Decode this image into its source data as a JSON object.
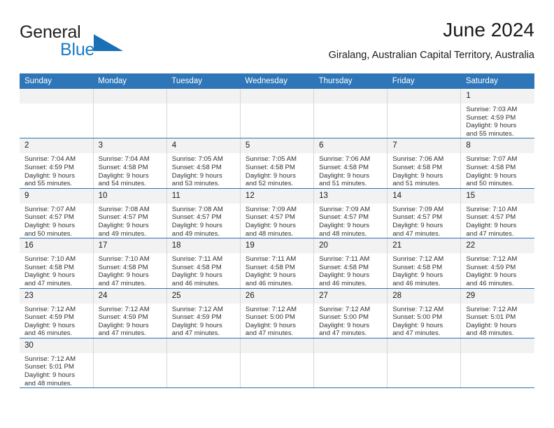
{
  "brand": {
    "name_top": "General",
    "name_bottom": "Blue",
    "triangle_icon": "blue-triangle-icon",
    "accent_color": "#1b7bc4"
  },
  "header": {
    "title": "June 2024",
    "subtitle": "Giralang, Australian Capital Territory, Australia"
  },
  "theme": {
    "header_bg": "#2e76b8",
    "header_text": "#ffffff",
    "daynum_bg": "#f2f2f2",
    "row_divider": "#2e76b8",
    "cell_divider": "#d6d6d6"
  },
  "weekday_headers": [
    "Sunday",
    "Monday",
    "Tuesday",
    "Wednesday",
    "Thursday",
    "Friday",
    "Saturday"
  ],
  "weeks": [
    [
      {
        "day": "",
        "sunrise": "",
        "sunset": "",
        "daylight_line1": "",
        "daylight_line2": "",
        "empty": true
      },
      {
        "day": "",
        "sunrise": "",
        "sunset": "",
        "daylight_line1": "",
        "daylight_line2": "",
        "empty": true
      },
      {
        "day": "",
        "sunrise": "",
        "sunset": "",
        "daylight_line1": "",
        "daylight_line2": "",
        "empty": true
      },
      {
        "day": "",
        "sunrise": "",
        "sunset": "",
        "daylight_line1": "",
        "daylight_line2": "",
        "empty": true
      },
      {
        "day": "",
        "sunrise": "",
        "sunset": "",
        "daylight_line1": "",
        "daylight_line2": "",
        "empty": true
      },
      {
        "day": "",
        "sunrise": "",
        "sunset": "",
        "daylight_line1": "",
        "daylight_line2": "",
        "empty": true
      },
      {
        "day": "1",
        "sunrise": "Sunrise: 7:03 AM",
        "sunset": "Sunset: 4:59 PM",
        "daylight_line1": "Daylight: 9 hours",
        "daylight_line2": "and 55 minutes.",
        "empty": false
      }
    ],
    [
      {
        "day": "2",
        "sunrise": "Sunrise: 7:04 AM",
        "sunset": "Sunset: 4:59 PM",
        "daylight_line1": "Daylight: 9 hours",
        "daylight_line2": "and 55 minutes.",
        "empty": false
      },
      {
        "day": "3",
        "sunrise": "Sunrise: 7:04 AM",
        "sunset": "Sunset: 4:58 PM",
        "daylight_line1": "Daylight: 9 hours",
        "daylight_line2": "and 54 minutes.",
        "empty": false
      },
      {
        "day": "4",
        "sunrise": "Sunrise: 7:05 AM",
        "sunset": "Sunset: 4:58 PM",
        "daylight_line1": "Daylight: 9 hours",
        "daylight_line2": "and 53 minutes.",
        "empty": false
      },
      {
        "day": "5",
        "sunrise": "Sunrise: 7:05 AM",
        "sunset": "Sunset: 4:58 PM",
        "daylight_line1": "Daylight: 9 hours",
        "daylight_line2": "and 52 minutes.",
        "empty": false
      },
      {
        "day": "6",
        "sunrise": "Sunrise: 7:06 AM",
        "sunset": "Sunset: 4:58 PM",
        "daylight_line1": "Daylight: 9 hours",
        "daylight_line2": "and 51 minutes.",
        "empty": false
      },
      {
        "day": "7",
        "sunrise": "Sunrise: 7:06 AM",
        "sunset": "Sunset: 4:58 PM",
        "daylight_line1": "Daylight: 9 hours",
        "daylight_line2": "and 51 minutes.",
        "empty": false
      },
      {
        "day": "8",
        "sunrise": "Sunrise: 7:07 AM",
        "sunset": "Sunset: 4:58 PM",
        "daylight_line1": "Daylight: 9 hours",
        "daylight_line2": "and 50 minutes.",
        "empty": false
      }
    ],
    [
      {
        "day": "9",
        "sunrise": "Sunrise: 7:07 AM",
        "sunset": "Sunset: 4:57 PM",
        "daylight_line1": "Daylight: 9 hours",
        "daylight_line2": "and 50 minutes.",
        "empty": false
      },
      {
        "day": "10",
        "sunrise": "Sunrise: 7:08 AM",
        "sunset": "Sunset: 4:57 PM",
        "daylight_line1": "Daylight: 9 hours",
        "daylight_line2": "and 49 minutes.",
        "empty": false
      },
      {
        "day": "11",
        "sunrise": "Sunrise: 7:08 AM",
        "sunset": "Sunset: 4:57 PM",
        "daylight_line1": "Daylight: 9 hours",
        "daylight_line2": "and 49 minutes.",
        "empty": false
      },
      {
        "day": "12",
        "sunrise": "Sunrise: 7:09 AM",
        "sunset": "Sunset: 4:57 PM",
        "daylight_line1": "Daylight: 9 hours",
        "daylight_line2": "and 48 minutes.",
        "empty": false
      },
      {
        "day": "13",
        "sunrise": "Sunrise: 7:09 AM",
        "sunset": "Sunset: 4:57 PM",
        "daylight_line1": "Daylight: 9 hours",
        "daylight_line2": "and 48 minutes.",
        "empty": false
      },
      {
        "day": "14",
        "sunrise": "Sunrise: 7:09 AM",
        "sunset": "Sunset: 4:57 PM",
        "daylight_line1": "Daylight: 9 hours",
        "daylight_line2": "and 47 minutes.",
        "empty": false
      },
      {
        "day": "15",
        "sunrise": "Sunrise: 7:10 AM",
        "sunset": "Sunset: 4:57 PM",
        "daylight_line1": "Daylight: 9 hours",
        "daylight_line2": "and 47 minutes.",
        "empty": false
      }
    ],
    [
      {
        "day": "16",
        "sunrise": "Sunrise: 7:10 AM",
        "sunset": "Sunset: 4:58 PM",
        "daylight_line1": "Daylight: 9 hours",
        "daylight_line2": "and 47 minutes.",
        "empty": false
      },
      {
        "day": "17",
        "sunrise": "Sunrise: 7:10 AM",
        "sunset": "Sunset: 4:58 PM",
        "daylight_line1": "Daylight: 9 hours",
        "daylight_line2": "and 47 minutes.",
        "empty": false
      },
      {
        "day": "18",
        "sunrise": "Sunrise: 7:11 AM",
        "sunset": "Sunset: 4:58 PM",
        "daylight_line1": "Daylight: 9 hours",
        "daylight_line2": "and 46 minutes.",
        "empty": false
      },
      {
        "day": "19",
        "sunrise": "Sunrise: 7:11 AM",
        "sunset": "Sunset: 4:58 PM",
        "daylight_line1": "Daylight: 9 hours",
        "daylight_line2": "and 46 minutes.",
        "empty": false
      },
      {
        "day": "20",
        "sunrise": "Sunrise: 7:11 AM",
        "sunset": "Sunset: 4:58 PM",
        "daylight_line1": "Daylight: 9 hours",
        "daylight_line2": "and 46 minutes.",
        "empty": false
      },
      {
        "day": "21",
        "sunrise": "Sunrise: 7:12 AM",
        "sunset": "Sunset: 4:58 PM",
        "daylight_line1": "Daylight: 9 hours",
        "daylight_line2": "and 46 minutes.",
        "empty": false
      },
      {
        "day": "22",
        "sunrise": "Sunrise: 7:12 AM",
        "sunset": "Sunset: 4:59 PM",
        "daylight_line1": "Daylight: 9 hours",
        "daylight_line2": "and 46 minutes.",
        "empty": false
      }
    ],
    [
      {
        "day": "23",
        "sunrise": "Sunrise: 7:12 AM",
        "sunset": "Sunset: 4:59 PM",
        "daylight_line1": "Daylight: 9 hours",
        "daylight_line2": "and 46 minutes.",
        "empty": false
      },
      {
        "day": "24",
        "sunrise": "Sunrise: 7:12 AM",
        "sunset": "Sunset: 4:59 PM",
        "daylight_line1": "Daylight: 9 hours",
        "daylight_line2": "and 47 minutes.",
        "empty": false
      },
      {
        "day": "25",
        "sunrise": "Sunrise: 7:12 AM",
        "sunset": "Sunset: 4:59 PM",
        "daylight_line1": "Daylight: 9 hours",
        "daylight_line2": "and 47 minutes.",
        "empty": false
      },
      {
        "day": "26",
        "sunrise": "Sunrise: 7:12 AM",
        "sunset": "Sunset: 5:00 PM",
        "daylight_line1": "Daylight: 9 hours",
        "daylight_line2": "and 47 minutes.",
        "empty": false
      },
      {
        "day": "27",
        "sunrise": "Sunrise: 7:12 AM",
        "sunset": "Sunset: 5:00 PM",
        "daylight_line1": "Daylight: 9 hours",
        "daylight_line2": "and 47 minutes.",
        "empty": false
      },
      {
        "day": "28",
        "sunrise": "Sunrise: 7:12 AM",
        "sunset": "Sunset: 5:00 PM",
        "daylight_line1": "Daylight: 9 hours",
        "daylight_line2": "and 47 minutes.",
        "empty": false
      },
      {
        "day": "29",
        "sunrise": "Sunrise: 7:12 AM",
        "sunset": "Sunset: 5:01 PM",
        "daylight_line1": "Daylight: 9 hours",
        "daylight_line2": "and 48 minutes.",
        "empty": false
      }
    ],
    [
      {
        "day": "30",
        "sunrise": "Sunrise: 7:12 AM",
        "sunset": "Sunset: 5:01 PM",
        "daylight_line1": "Daylight: 9 hours",
        "daylight_line2": "and 48 minutes.",
        "empty": false
      },
      {
        "day": "",
        "sunrise": "",
        "sunset": "",
        "daylight_line1": "",
        "daylight_line2": "",
        "empty": true
      },
      {
        "day": "",
        "sunrise": "",
        "sunset": "",
        "daylight_line1": "",
        "daylight_line2": "",
        "empty": true
      },
      {
        "day": "",
        "sunrise": "",
        "sunset": "",
        "daylight_line1": "",
        "daylight_line2": "",
        "empty": true
      },
      {
        "day": "",
        "sunrise": "",
        "sunset": "",
        "daylight_line1": "",
        "daylight_line2": "",
        "empty": true
      },
      {
        "day": "",
        "sunrise": "",
        "sunset": "",
        "daylight_line1": "",
        "daylight_line2": "",
        "empty": true
      },
      {
        "day": "",
        "sunrise": "",
        "sunset": "",
        "daylight_line1": "",
        "daylight_line2": "",
        "empty": true
      }
    ]
  ]
}
